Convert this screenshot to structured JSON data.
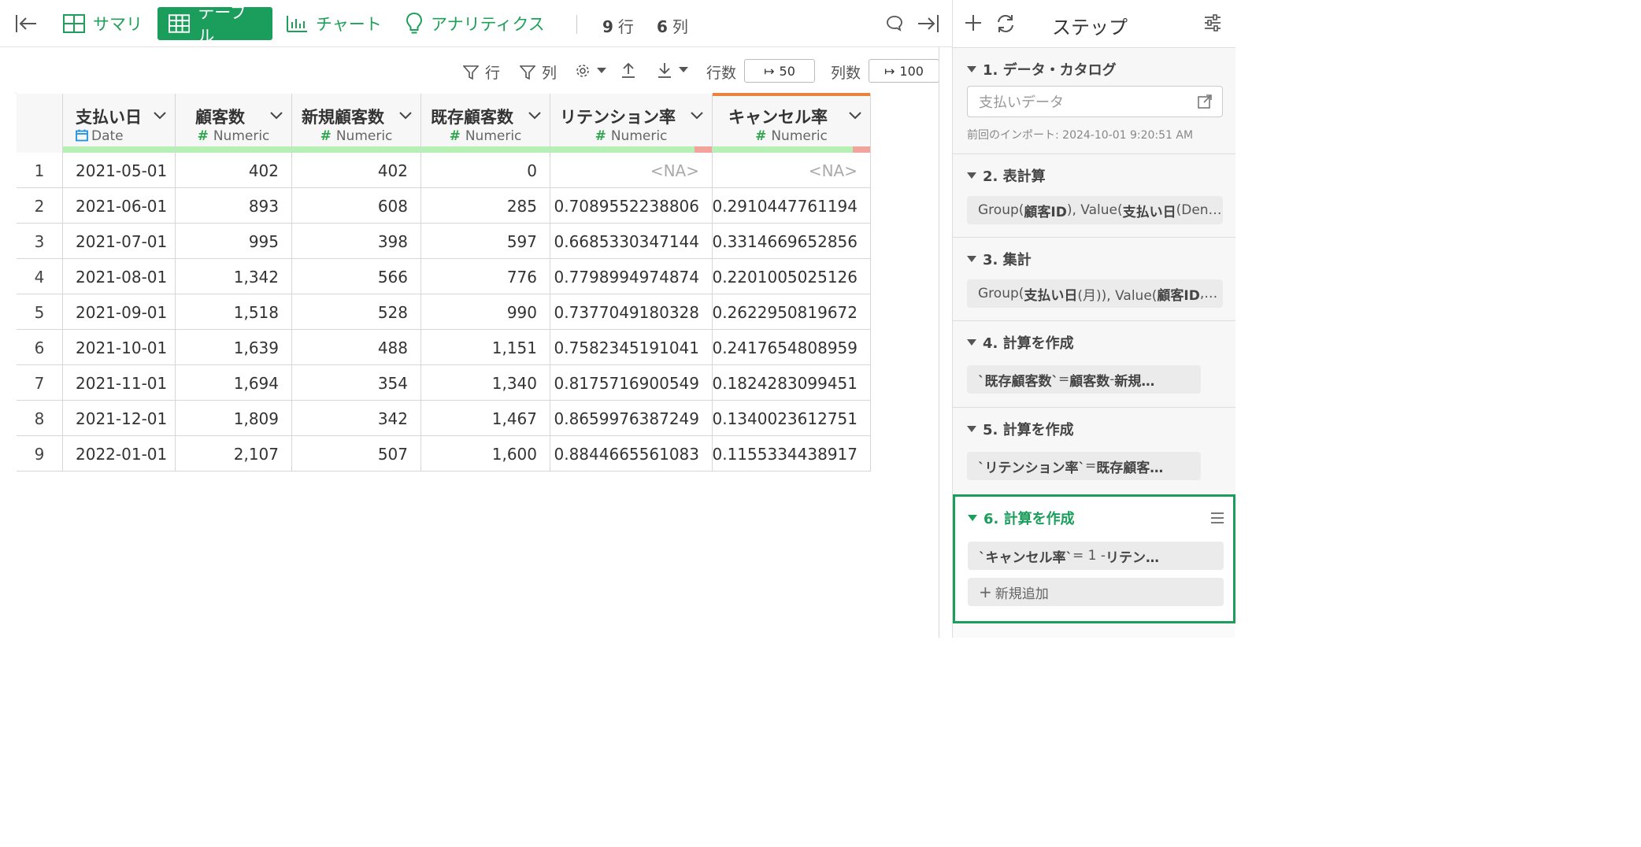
{
  "topbar": {
    "tabs": [
      {
        "label": "サマリ",
        "icon": "summary-grid-icon"
      },
      {
        "label": "テーブル",
        "icon": "table-icon",
        "active": true
      },
      {
        "label": "チャート",
        "icon": "chart-icon"
      },
      {
        "label": "アナリティクス",
        "icon": "lightbulb-icon"
      }
    ],
    "rows_count": "9",
    "rows_unit": "行",
    "cols_count": "6",
    "cols_unit": "列"
  },
  "toolbar": {
    "row_filter": "行",
    "col_filter": "列",
    "rows_label": "行数",
    "rows_value": "50",
    "cols_label": "列数",
    "cols_value": "100"
  },
  "table": {
    "columns": [
      {
        "name": "支払い日",
        "type": "Date"
      },
      {
        "name": "顧客数",
        "type": "Numeric"
      },
      {
        "name": "新規顧客数",
        "type": "Numeric"
      },
      {
        "name": "既存顧客数",
        "type": "Numeric"
      },
      {
        "name": "リテンション率",
        "type": "Numeric"
      },
      {
        "name": "キャンセル率",
        "type": "Numeric"
      }
    ],
    "rows": [
      [
        "1",
        "2021-05-01",
        "402",
        "402",
        "0",
        "<NA>",
        "<NA>"
      ],
      [
        "2",
        "2021-06-01",
        "893",
        "608",
        "285",
        "0.7089552238806",
        "0.2910447761194"
      ],
      [
        "3",
        "2021-07-01",
        "995",
        "398",
        "597",
        "0.6685330347144",
        "0.3314669652856"
      ],
      [
        "4",
        "2021-08-01",
        "1,342",
        "566",
        "776",
        "0.7798994974874",
        "0.2201005025126"
      ],
      [
        "5",
        "2021-09-01",
        "1,518",
        "528",
        "990",
        "0.7377049180328",
        "0.2622950819672"
      ],
      [
        "6",
        "2021-10-01",
        "1,639",
        "488",
        "1,151",
        "0.7582345191041",
        "0.2417654808959"
      ],
      [
        "7",
        "2021-11-01",
        "1,694",
        "354",
        "1,340",
        "0.8175716900549",
        "0.1824283099451"
      ],
      [
        "8",
        "2021-12-01",
        "1,809",
        "342",
        "1,467",
        "0.8659976387249",
        "0.1340023612751"
      ],
      [
        "9",
        "2022-01-01",
        "2,107",
        "507",
        "1,600",
        "0.8844665561083",
        "0.1155334438917"
      ]
    ]
  },
  "panel": {
    "title": "ステップ",
    "steps": [
      {
        "title": "1. データ・カタログ",
        "source": "支払いデータ",
        "note": "前回のインポート: 2024-10-01 9:20:51 AM"
      },
      {
        "title": "2. 表計算",
        "summary_html": "Group(<b>顧客ID</b>), Value(<b>支払い日</b> (Den…"
      },
      {
        "title": "3. 集計",
        "summary_html": "Group(<b>支払い日</b> (月)), Value(<b>顧客ID</b>,…"
      },
      {
        "title": "4. 計算を作成",
        "summary_html": "<b>`既存顧客数`</b> = <b>顧客数</b> - <b>新規…</b>"
      },
      {
        "title": "5. 計算を作成",
        "summary_html": "<b>`リテンション率`</b> = <b>既存顧客…</b>"
      },
      {
        "title": "6. 計算を作成",
        "summary_html": "<b>`キャンセル率`</b> = 1 - <b>リテン…</b>",
        "add_label": "新規追加"
      }
    ]
  }
}
